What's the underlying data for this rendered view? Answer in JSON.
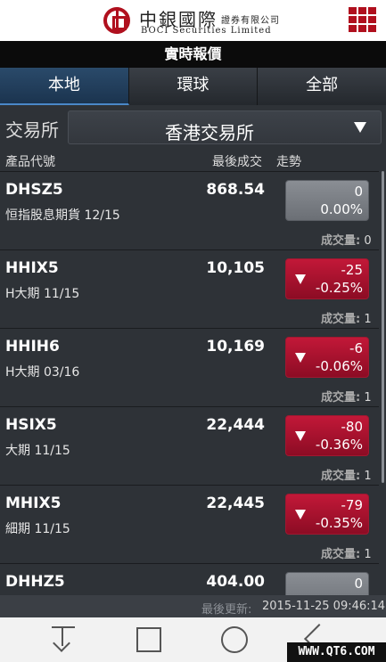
{
  "header": {
    "logo_cn": "中銀國際",
    "logo_cn_small": "證券有限公司",
    "logo_en": "BOCI Securities Limited"
  },
  "title": "實時報價",
  "tabs": [
    {
      "label": "本地",
      "active": true
    },
    {
      "label": "環球",
      "active": false
    },
    {
      "label": "全部",
      "active": false
    }
  ],
  "exchange": {
    "label": "交易所",
    "value": "香港交易所"
  },
  "columns": {
    "product": "產品代號",
    "last": "最後成交",
    "trend": "走勢"
  },
  "volume_label": "成交量:",
  "rows": [
    {
      "code": "DHSZ5",
      "name": "恒指股息期貨 12/15",
      "price": "868.54",
      "change": "0",
      "pct": "0.00%",
      "direction": "flat",
      "volume": "0"
    },
    {
      "code": "HHIX5",
      "name": "H大期 11/15",
      "price": "10,105",
      "change": "-25",
      "pct": "-0.25%",
      "direction": "down",
      "volume": "1"
    },
    {
      "code": "HHIH6",
      "name": "H大期 03/16",
      "price": "10,169",
      "change": "-6",
      "pct": "-0.06%",
      "direction": "down",
      "volume": "1"
    },
    {
      "code": "HSIX5",
      "name": "大期 11/15",
      "price": "22,444",
      "change": "-80",
      "pct": "-0.36%",
      "direction": "down",
      "volume": "1"
    },
    {
      "code": "MHIX5",
      "name": "細期 11/15",
      "price": "22,445",
      "change": "-79",
      "pct": "-0.35%",
      "direction": "down",
      "volume": "1"
    },
    {
      "code": "DHHZ5",
      "name": "",
      "price": "404.00",
      "change": "0",
      "pct": "",
      "direction": "flat",
      "volume": ""
    }
  ],
  "update": {
    "label": "最後更新:",
    "value": "2015-11-25 09:46:14"
  },
  "watermark": "WWW.QT6.COM",
  "colors": {
    "down": "#c21838",
    "flat": "#7a7e84",
    "header_red": "#b0101e",
    "active_tab": "#1b344f"
  }
}
